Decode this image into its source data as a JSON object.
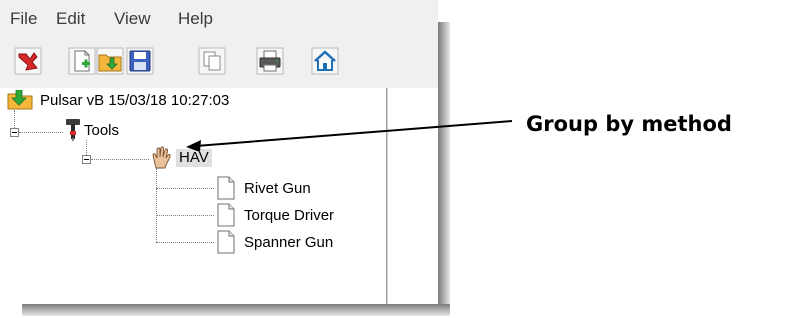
{
  "menubar": {
    "items": [
      "File",
      "Edit",
      "View",
      "Help"
    ]
  },
  "toolbar": {
    "buttons": [
      "exit-icon",
      "new-icon",
      "open-icon",
      "save-icon",
      "copy-icon",
      "print-icon",
      "home-icon"
    ]
  },
  "tree": {
    "root": {
      "label": "Pulsar vB 15/03/18 10:27:03",
      "icon": "folder-download-icon"
    },
    "tools": {
      "label": "Tools",
      "icon": "tool-icon",
      "expanded": true
    },
    "group": {
      "label": "HAV",
      "icon": "hand-icon",
      "expanded": true,
      "selected": true
    },
    "leaves": [
      "Rivet Gun",
      "Torque Driver",
      "Spanner Gun"
    ],
    "leaf_icon": "document-icon"
  },
  "callout": {
    "label": "Group by method"
  },
  "colors": {
    "window_bg": "#f0f0f0",
    "tree_bg": "#ffffff",
    "selection_bg": "#e0e0e0",
    "exit_red": "#d62828",
    "folder_orange": "#f5b73b",
    "save_blue": "#3c5fbf"
  }
}
